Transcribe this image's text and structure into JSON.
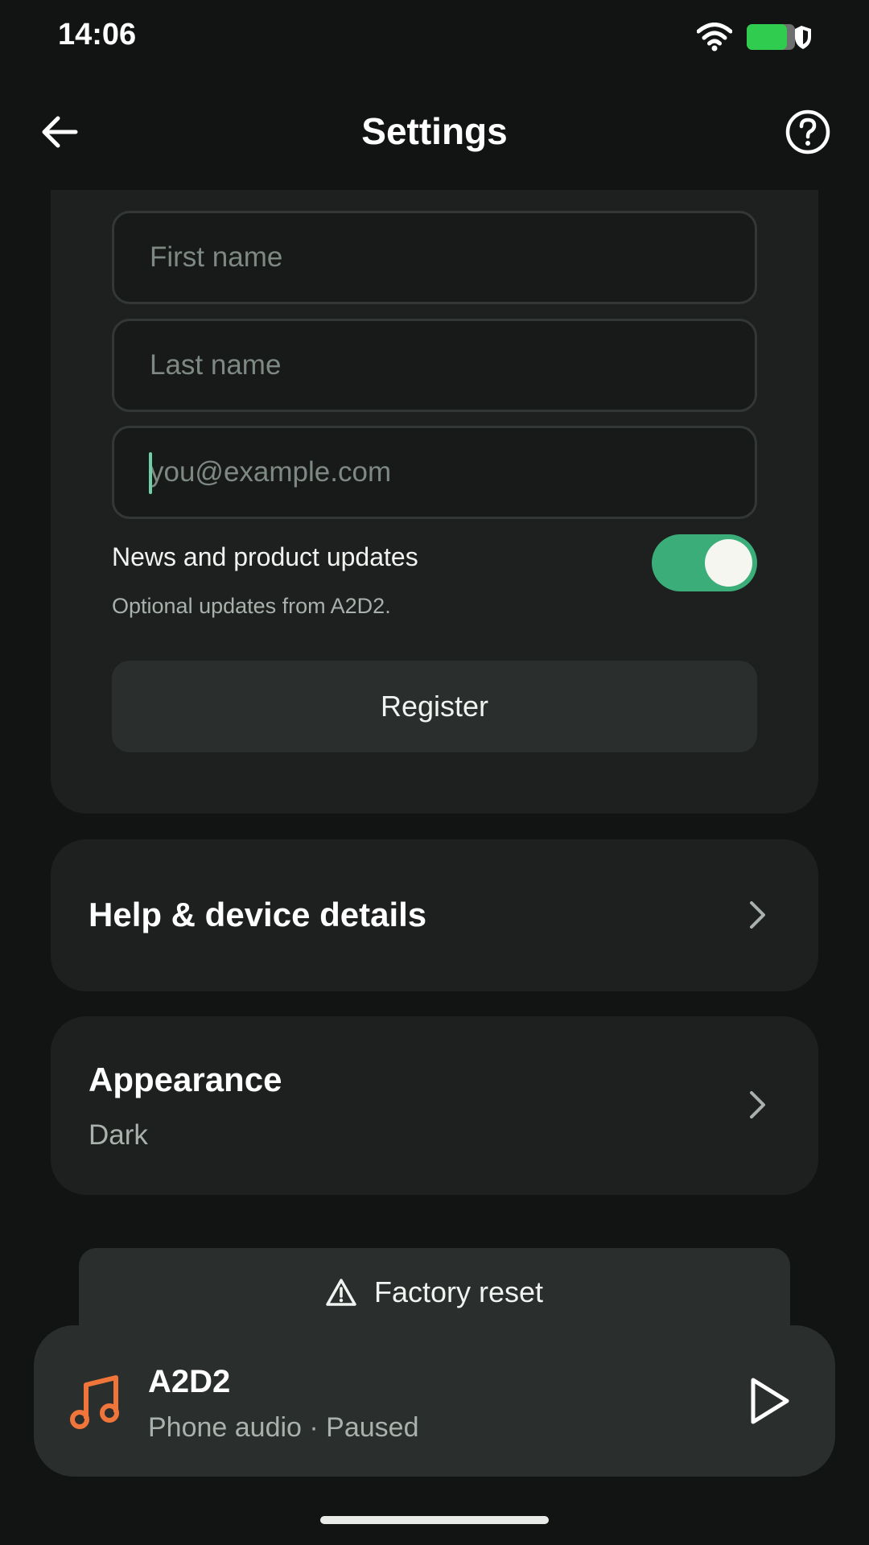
{
  "status_bar": {
    "time": "14:06",
    "icons": [
      "wifi-icon",
      "battery-icon",
      "shield-icon"
    ],
    "battery_color": "#2fcc4f"
  },
  "top_bar": {
    "title": "Settings",
    "back_icon": "arrow-left-icon",
    "help_icon": "help-circle-icon"
  },
  "register_form": {
    "first_name_placeholder": "First name",
    "last_name_placeholder": "Last name",
    "email_placeholder": "you@example.com",
    "news_label": "News and product updates",
    "news_sub": "Optional updates from A2D2.",
    "news_enabled": true,
    "register_label": "Register"
  },
  "cards": {
    "help": {
      "title": "Help & device details"
    },
    "appearance": {
      "title": "Appearance",
      "value": "Dark"
    }
  },
  "factory_reset": {
    "label": "Factory reset",
    "icon": "warning-icon"
  },
  "player": {
    "title": "A2D2",
    "subtitle": "Phone audio · Paused",
    "icon": "music-note-icon",
    "icon_color": "#f0753a",
    "play_icon": "play-icon"
  },
  "colors": {
    "background": "#121413",
    "card": "#1d201e",
    "accent_toggle": "#3aad78"
  }
}
